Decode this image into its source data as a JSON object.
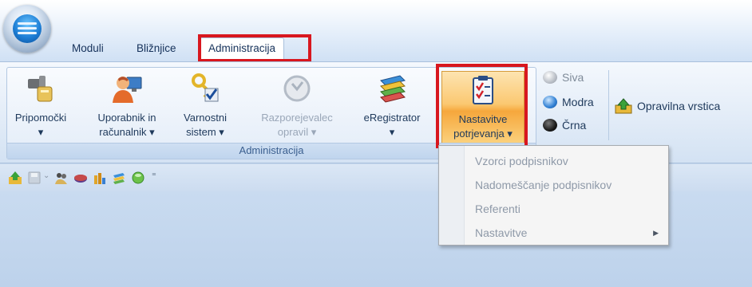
{
  "tabs": [
    {
      "label": "Moduli"
    },
    {
      "label": "Bližnjice"
    },
    {
      "label": "Administracija",
      "active": true
    }
  ],
  "ribbon": {
    "group_label": "Administracija",
    "buttons": [
      {
        "line1": "Pripomočki",
        "line2": "▾",
        "icon": "tools-icon",
        "enabled": true
      },
      {
        "line1": "Uporabnik in",
        "line2": "računalnik ▾",
        "icon": "user-computer-icon",
        "enabled": true
      },
      {
        "line1": "Varnostni",
        "line2": "sistem ▾",
        "icon": "security-keys-icon",
        "enabled": true
      },
      {
        "line1": "Razporejevalec",
        "line2": "opravil ▾",
        "icon": "scheduler-clock-icon",
        "enabled": false
      },
      {
        "line1": "eRegistrator",
        "line2": "▾",
        "icon": "books-stack-icon",
        "enabled": true
      },
      {
        "line1": "Nastavitve",
        "line2": "potrjevanja ▾",
        "icon": "checklist-icon",
        "enabled": true,
        "active": true
      }
    ],
    "themes": [
      {
        "label": "Siva",
        "color": "#b9bec6"
      },
      {
        "label": "Modra",
        "color": "#2f7fd3"
      },
      {
        "label": "Črna",
        "color": "#1a1a1a"
      }
    ],
    "taskbar_label": "Opravilna vrstica"
  },
  "qat": {
    "icons": [
      "taskbar-up-icon",
      "save-icon",
      "separator",
      "users-icon",
      "disc-icon",
      "bars-chart-icon",
      "books-icon",
      "green-orb-icon",
      "customize-dropdown-icon"
    ]
  },
  "dropdown": {
    "items": [
      {
        "label": "Vzorci podpisnikov",
        "submenu": false
      },
      {
        "label": "Nadomeščanje podpisnikov",
        "submenu": false
      },
      {
        "label": "Referenti",
        "submenu": false
      },
      {
        "label": "Nastavitve",
        "submenu": true
      }
    ]
  }
}
